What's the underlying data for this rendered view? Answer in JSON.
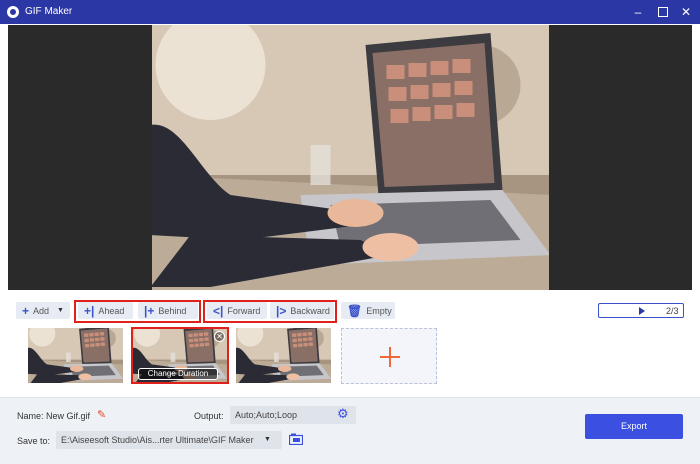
{
  "window": {
    "title": "GIF Maker"
  },
  "toolbar": {
    "add_label": "Add",
    "ahead_label": "Ahead",
    "behind_label": "Behind",
    "forward_label": "Forward",
    "backward_label": "Backward",
    "empty_label": "Empty"
  },
  "playback": {
    "counter": "2/3"
  },
  "frames": {
    "change_duration_label": "Change Duration"
  },
  "settings": {
    "name_label": "Name:",
    "name_value": "New Gif.gif",
    "output_label": "Output:",
    "output_value": "Auto;Auto;Loop",
    "save_label": "Save to:",
    "save_path": "E:\\Aiseesoft Studio\\Ais...rter Ultimate\\GIF Maker",
    "export_label": "Export"
  },
  "colors": {
    "accent": "#3b4fe0",
    "titlebar": "#2c37a6",
    "highlight": "#e0201a",
    "add_plus": "#f06838"
  }
}
